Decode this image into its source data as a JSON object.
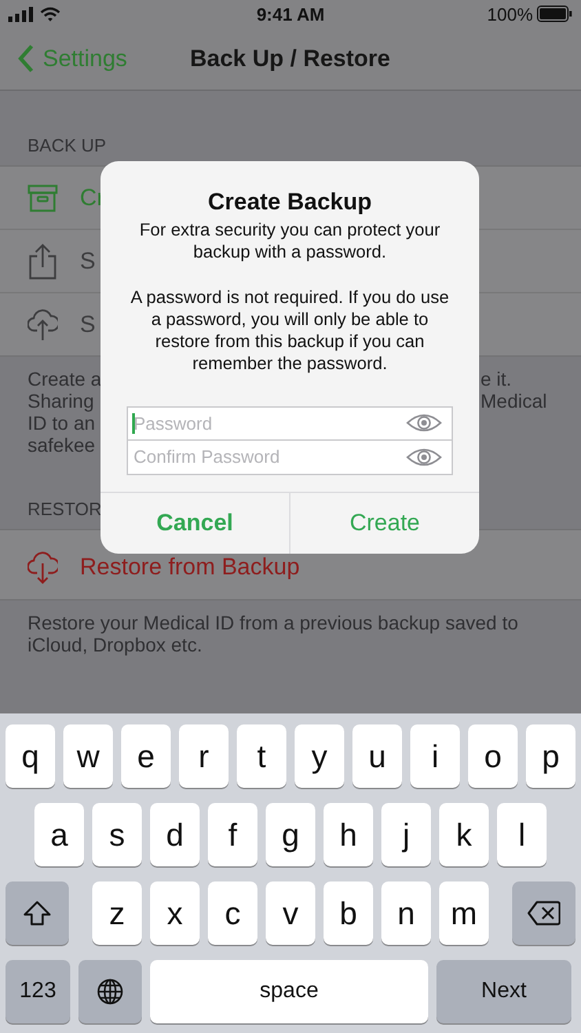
{
  "status_bar": {
    "time": "9:41 AM",
    "battery": "100%"
  },
  "nav": {
    "back": "Settings",
    "title": "Back Up / Restore"
  },
  "sections": [
    {
      "header": "BACK UP",
      "rows": [
        {
          "label": "Cr",
          "color": "#2f7d32"
        },
        {
          "label": "S",
          "color": "#3d3d3f"
        },
        {
          "label": "S",
          "color": "#3d3d3f"
        }
      ],
      "footer_lines": [
        {
          "left": "Create a",
          "right": "e it."
        },
        {
          "left": "Sharing",
          "right": "Medical"
        },
        {
          "left": "ID to an"
        },
        {
          "left": "safekee"
        }
      ]
    },
    {
      "header": "RESTOR",
      "rows": [
        {
          "label": "Restore from Backup",
          "color": "#8e1d1d"
        }
      ],
      "footer": "Restore your Medical ID from a previous backup saved to iCloud, Dropbox etc."
    }
  ],
  "dialog": {
    "title": "Create Backup",
    "message": [
      "For extra security you can protect your backup with a password.",
      "A password is not required. If you do use a password, you will only be able to restore from this backup if you can remember the password."
    ],
    "fields": [
      {
        "placeholder": "Password",
        "focused": true
      },
      {
        "placeholder": "Confirm Password",
        "focused": false
      }
    ],
    "buttons": [
      {
        "label": "Cancel",
        "bold": true
      },
      {
        "label": "Create",
        "bold": false
      }
    ]
  },
  "keyboard": {
    "rows": [
      {
        "keys": [
          {
            "kind": "letter",
            "label": "q"
          },
          {
            "kind": "letter",
            "label": "w"
          },
          {
            "kind": "letter",
            "label": "e"
          },
          {
            "kind": "letter",
            "label": "r"
          },
          {
            "kind": "letter",
            "label": "t"
          },
          {
            "kind": "letter",
            "label": "y"
          },
          {
            "kind": "letter",
            "label": "u"
          },
          {
            "kind": "letter",
            "label": "i"
          },
          {
            "kind": "letter",
            "label": "o"
          },
          {
            "kind": "letter",
            "label": "p"
          }
        ]
      },
      {
        "keys": [
          {
            "kind": "letter",
            "label": "a"
          },
          {
            "kind": "letter",
            "label": "s"
          },
          {
            "kind": "letter",
            "label": "d"
          },
          {
            "kind": "letter",
            "label": "f"
          },
          {
            "kind": "letter",
            "label": "g"
          },
          {
            "kind": "letter",
            "label": "h"
          },
          {
            "kind": "letter",
            "label": "j"
          },
          {
            "kind": "letter",
            "label": "k"
          },
          {
            "kind": "letter",
            "label": "l"
          }
        ]
      },
      {
        "keys": [
          {
            "kind": "shift"
          },
          {
            "kind": "letter",
            "label": "z"
          },
          {
            "kind": "letter",
            "label": "x"
          },
          {
            "kind": "letter",
            "label": "c"
          },
          {
            "kind": "letter",
            "label": "v"
          },
          {
            "kind": "letter",
            "label": "b"
          },
          {
            "kind": "letter",
            "label": "n"
          },
          {
            "kind": "letter",
            "label": "m"
          },
          {
            "kind": "delete"
          }
        ]
      },
      {
        "keys": [
          {
            "kind": "numbers",
            "label": "123"
          },
          {
            "kind": "globe"
          },
          {
            "kind": "space",
            "label": "space"
          },
          {
            "kind": "return",
            "label": "Next"
          }
        ]
      }
    ]
  }
}
